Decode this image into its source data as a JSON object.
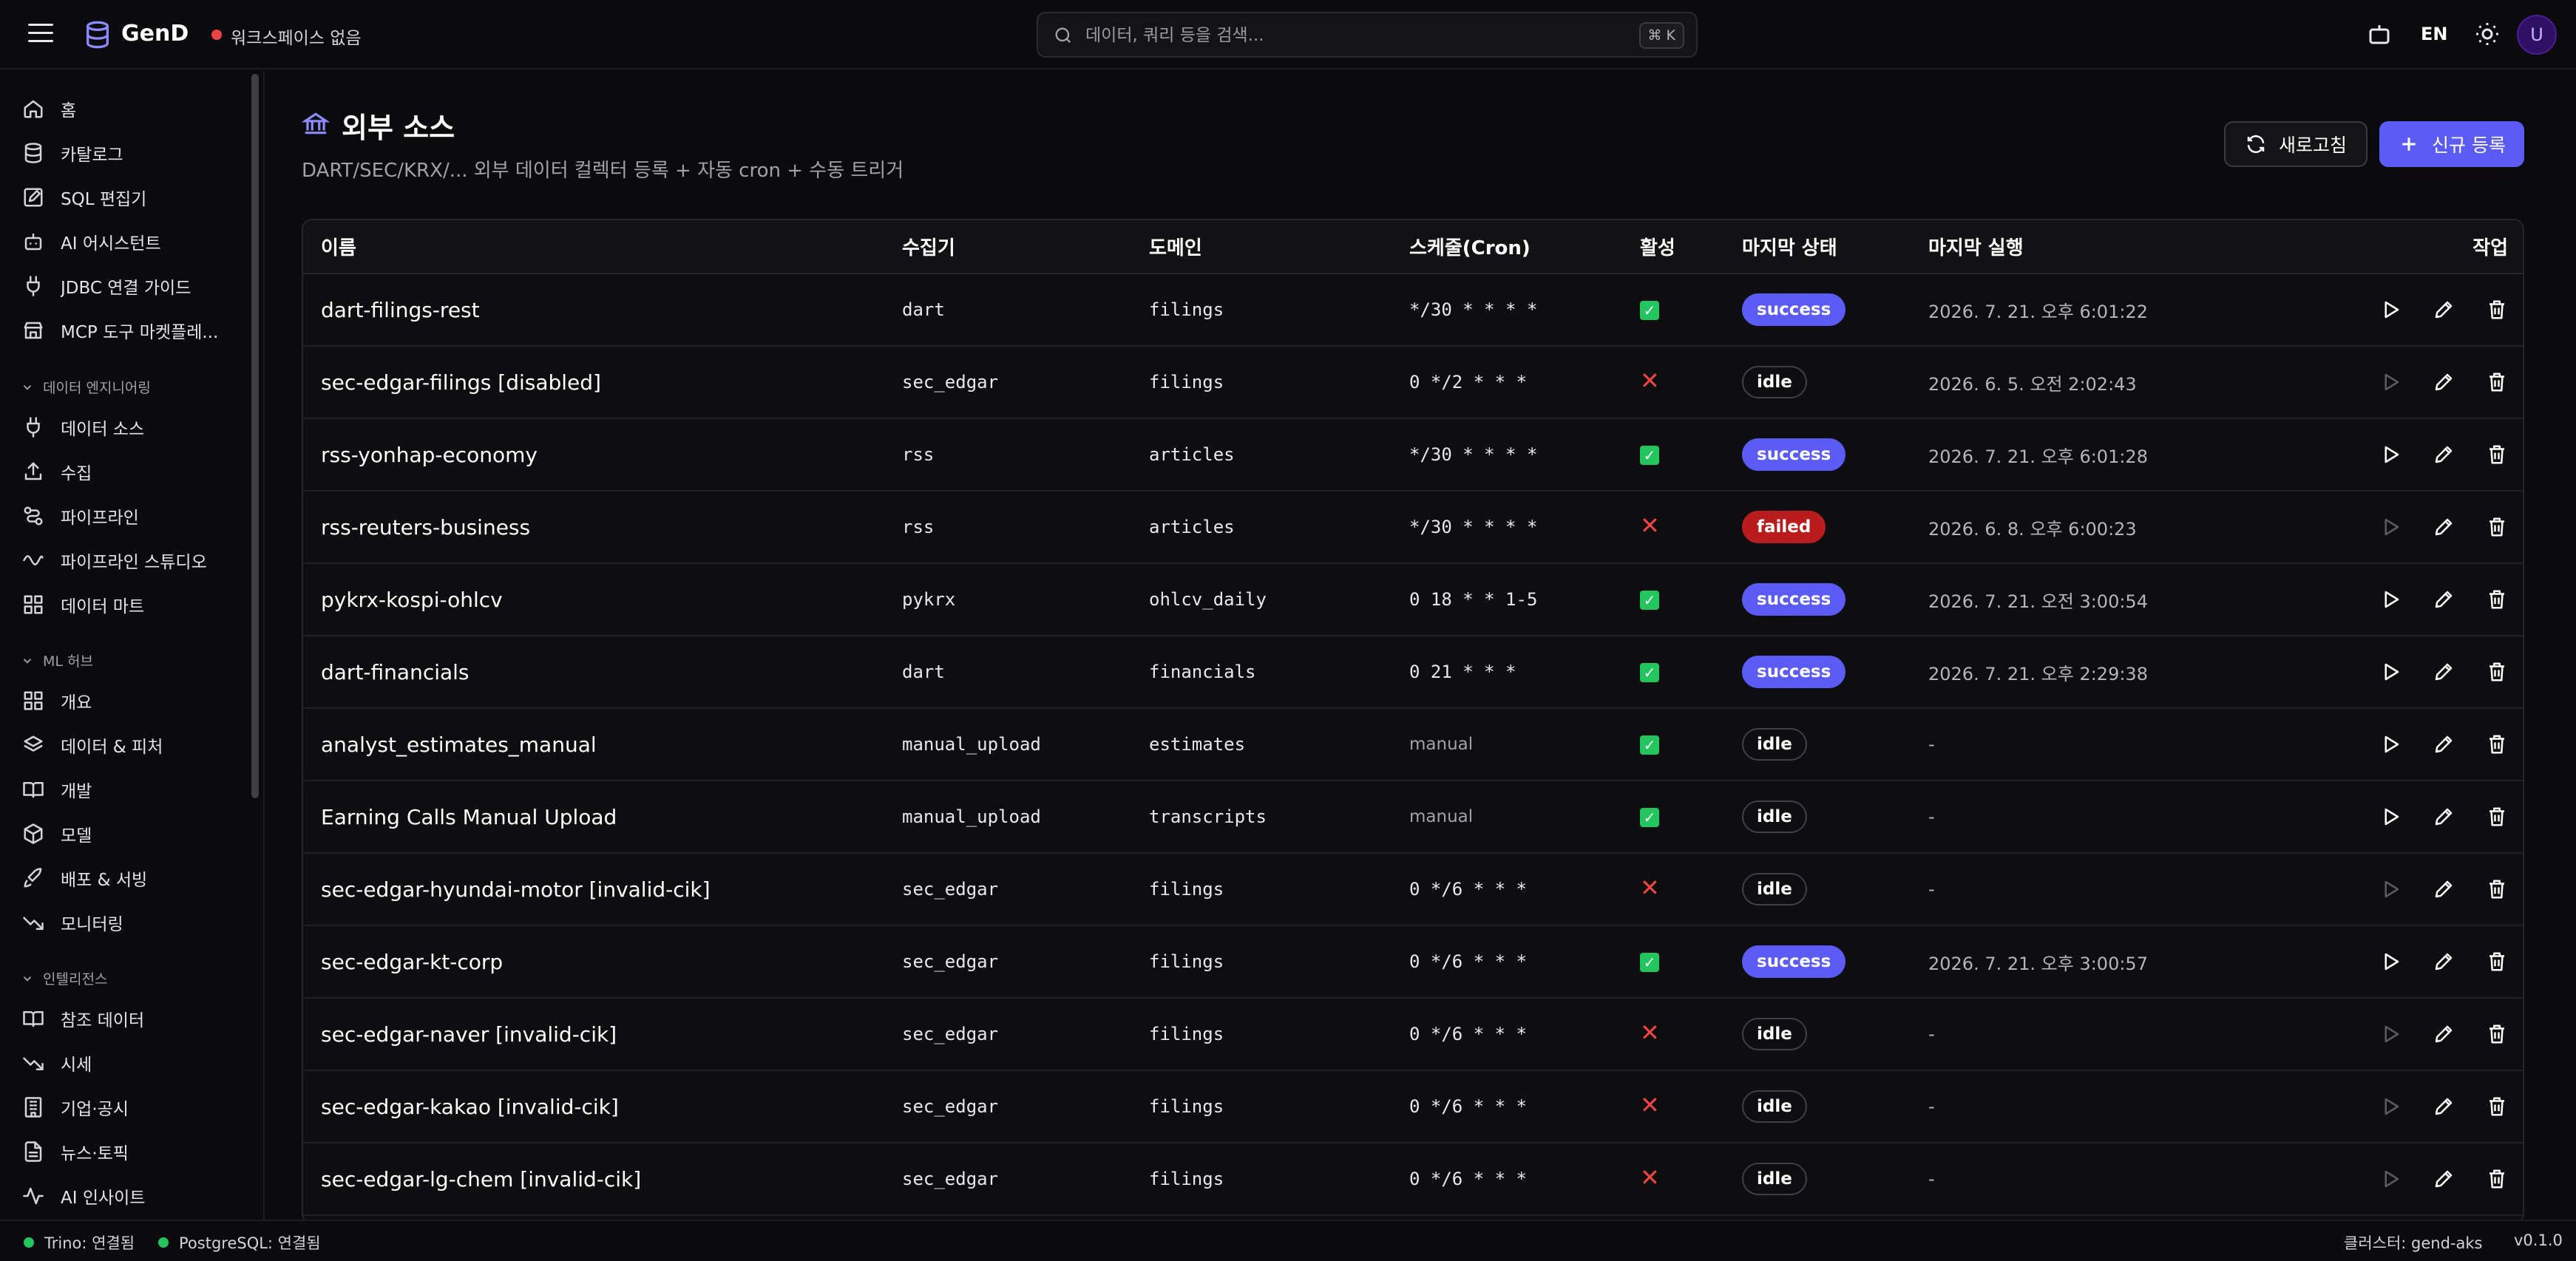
{
  "header": {
    "app_name": "GenD",
    "workspace": "워크스페이스 없음",
    "search_placeholder": "데이터, 쿼리 등을 검색...",
    "search_shortcut": "⌘ K",
    "lang": "EN",
    "avatar": "U"
  },
  "sidebar": {
    "items_top": [
      {
        "label": "홈",
        "icon": "home-icon"
      },
      {
        "label": "카탈로그",
        "icon": "database-icon"
      },
      {
        "label": "SQL 편집기",
        "icon": "edit-icon"
      },
      {
        "label": "AI 어시스턴트",
        "icon": "bot-icon"
      },
      {
        "label": "JDBC 연결 가이드",
        "icon": "plug-icon"
      },
      {
        "label": "MCP 도구 마켓플레...",
        "icon": "store-icon"
      }
    ],
    "group_data_eng": "데이터 엔지니어링",
    "items_data_eng": [
      {
        "label": "데이터 소스",
        "icon": "plug-icon"
      },
      {
        "label": "수집",
        "icon": "upload-icon"
      },
      {
        "label": "파이프라인",
        "icon": "pipeline-icon"
      },
      {
        "label": "파이프라인 스튜디오",
        "icon": "wave-icon"
      },
      {
        "label": "데이터 마트",
        "icon": "grid-icon"
      }
    ],
    "group_ml": "ML 허브",
    "items_ml": [
      {
        "label": "개요",
        "icon": "grid-icon"
      },
      {
        "label": "데이터 & 피처",
        "icon": "layers-icon"
      },
      {
        "label": "개발",
        "icon": "book-icon"
      },
      {
        "label": "모델",
        "icon": "box-icon"
      },
      {
        "label": "배포 & 서빙",
        "icon": "rocket-icon"
      },
      {
        "label": "모니터링",
        "icon": "trend-icon"
      }
    ],
    "group_intel": "인텔리전스",
    "items_intel": [
      {
        "label": "참조 데이터",
        "icon": "book-icon"
      },
      {
        "label": "시세",
        "icon": "trend-icon"
      },
      {
        "label": "기업·공시",
        "icon": "building-icon"
      },
      {
        "label": "뉴스·토픽",
        "icon": "file-icon"
      },
      {
        "label": "AI 인사이트",
        "icon": "activity-icon"
      }
    ]
  },
  "page": {
    "title": "외부 소스",
    "subtitle": "DART/SEC/KRX/... 외부 데이터 컬렉터 등록 + 자동 cron + 수동 트리거",
    "refresh_label": "새로고침",
    "new_label": "신규 등록"
  },
  "table": {
    "headers": {
      "name": "이름",
      "collector": "수집기",
      "domain": "도메인",
      "schedule": "스케줄(Cron)",
      "active": "활성",
      "last_status": "마지막 상태",
      "last_run": "마지막 실행",
      "actions": "작업"
    },
    "rows": [
      {
        "name": "dart-filings-rest",
        "collector": "dart",
        "domain": "filings",
        "cron": "*/30 * * * *",
        "active": true,
        "status": "success",
        "last_run": "2026. 7. 21. 오후 6:01:22"
      },
      {
        "name": "sec-edgar-filings [disabled]",
        "collector": "sec_edgar",
        "domain": "filings",
        "cron": "0 */2 * * *",
        "active": false,
        "status": "idle",
        "last_run": "2026. 6. 5. 오전 2:02:43"
      },
      {
        "name": "rss-yonhap-economy",
        "collector": "rss",
        "domain": "articles",
        "cron": "*/30 * * * *",
        "active": true,
        "status": "success",
        "last_run": "2026. 7. 21. 오후 6:01:28"
      },
      {
        "name": "rss-reuters-business",
        "collector": "rss",
        "domain": "articles",
        "cron": "*/30 * * * *",
        "active": false,
        "status": "failed",
        "last_run": "2026. 6. 8. 오후 6:00:23"
      },
      {
        "name": "pykrx-kospi-ohlcv",
        "collector": "pykrx",
        "domain": "ohlcv_daily",
        "cron": "0 18 * * 1-5",
        "active": true,
        "status": "success",
        "last_run": "2026. 7. 21. 오전 3:00:54"
      },
      {
        "name": "dart-financials",
        "collector": "dart",
        "domain": "financials",
        "cron": "0 21 * * *",
        "active": true,
        "status": "success",
        "last_run": "2026. 7. 21. 오후 2:29:38"
      },
      {
        "name": "analyst_estimates_manual",
        "collector": "manual_upload",
        "domain": "estimates",
        "cron": "manual",
        "active": true,
        "status": "idle",
        "last_run": "-"
      },
      {
        "name": "Earning Calls Manual Upload",
        "collector": "manual_upload",
        "domain": "transcripts",
        "cron": "manual",
        "active": true,
        "status": "idle",
        "last_run": "-"
      },
      {
        "name": "sec-edgar-hyundai-motor [invalid-cik]",
        "collector": "sec_edgar",
        "domain": "filings",
        "cron": "0 */6 * * *",
        "active": false,
        "status": "idle",
        "last_run": "-"
      },
      {
        "name": "sec-edgar-kt-corp",
        "collector": "sec_edgar",
        "domain": "filings",
        "cron": "0 */6 * * *",
        "active": true,
        "status": "success",
        "last_run": "2026. 7. 21. 오후 3:00:57"
      },
      {
        "name": "sec-edgar-naver [invalid-cik]",
        "collector": "sec_edgar",
        "domain": "filings",
        "cron": "0 */6 * * *",
        "active": false,
        "status": "idle",
        "last_run": "-"
      },
      {
        "name": "sec-edgar-kakao [invalid-cik]",
        "collector": "sec_edgar",
        "domain": "filings",
        "cron": "0 */6 * * *",
        "active": false,
        "status": "idle",
        "last_run": "-"
      },
      {
        "name": "sec-edgar-lg-chem [invalid-cik]",
        "collector": "sec_edgar",
        "domain": "filings",
        "cron": "0 */6 * * *",
        "active": false,
        "status": "idle",
        "last_run": "-"
      }
    ]
  },
  "statusbar": {
    "trino": "Trino: 연결됨",
    "postgres": "PostgreSQL: 연결됨",
    "cluster": "클러스터: gend-aks",
    "version": "v0.1.0"
  },
  "colors": {
    "accent": "#5b5bf5",
    "success": "#22c55e",
    "danger": "#ef4444"
  }
}
